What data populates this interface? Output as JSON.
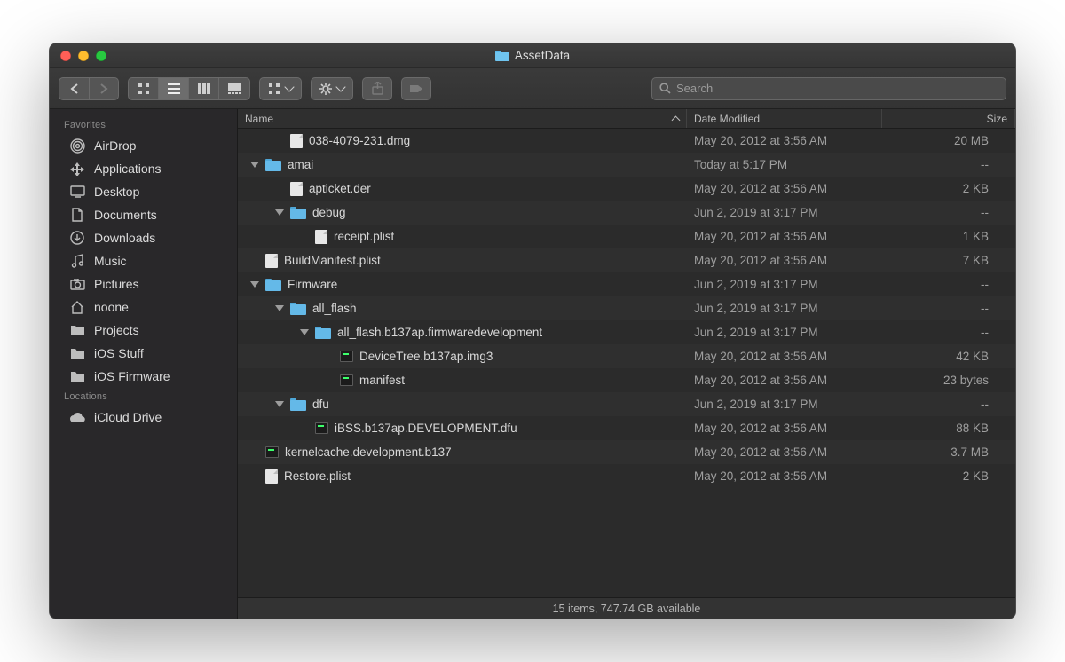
{
  "window": {
    "title": "AssetData"
  },
  "search": {
    "placeholder": "Search"
  },
  "columns": {
    "name": "Name",
    "date": "Date Modified",
    "size": "Size"
  },
  "sidebar": {
    "sections": [
      {
        "heading": "Favorites",
        "items": [
          {
            "icon": "airdrop",
            "label": "AirDrop"
          },
          {
            "icon": "apps",
            "label": "Applications"
          },
          {
            "icon": "desktop",
            "label": "Desktop"
          },
          {
            "icon": "documents",
            "label": "Documents"
          },
          {
            "icon": "downloads",
            "label": "Downloads"
          },
          {
            "icon": "music",
            "label": "Music"
          },
          {
            "icon": "pictures",
            "label": "Pictures"
          },
          {
            "icon": "home",
            "label": "noone"
          },
          {
            "icon": "folder",
            "label": "Projects"
          },
          {
            "icon": "folder",
            "label": "iOS Stuff"
          },
          {
            "icon": "folder",
            "label": "iOS Firmware"
          }
        ]
      },
      {
        "heading": "Locations",
        "items": [
          {
            "icon": "icloud",
            "label": "iCloud Drive"
          }
        ]
      }
    ]
  },
  "rows": [
    {
      "indent": 1,
      "disclosure": null,
      "kind": "doc",
      "name": "038-4079-231.dmg",
      "date": "May 20, 2012 at 3:56 AM",
      "size": "20 MB"
    },
    {
      "indent": 0,
      "disclosure": "open",
      "kind": "folder",
      "name": "amai",
      "date": "Today at 5:17 PM",
      "size": "--"
    },
    {
      "indent": 1,
      "disclosure": null,
      "kind": "doc",
      "name": "apticket.der",
      "date": "May 20, 2012 at 3:56 AM",
      "size": "2 KB"
    },
    {
      "indent": 1,
      "disclosure": "open",
      "kind": "folder",
      "name": "debug",
      "date": "Jun 2, 2019 at 3:17 PM",
      "size": "--"
    },
    {
      "indent": 2,
      "disclosure": null,
      "kind": "doc",
      "name": "receipt.plist",
      "date": "May 20, 2012 at 3:56 AM",
      "size": "1 KB"
    },
    {
      "indent": 0,
      "disclosure": null,
      "kind": "doc",
      "name": "BuildManifest.plist",
      "date": "May 20, 2012 at 3:56 AM",
      "size": "7 KB"
    },
    {
      "indent": 0,
      "disclosure": "open",
      "kind": "folder",
      "name": "Firmware",
      "date": "Jun 2, 2019 at 3:17 PM",
      "size": "--"
    },
    {
      "indent": 1,
      "disclosure": "open",
      "kind": "folder",
      "name": "all_flash",
      "date": "Jun 2, 2019 at 3:17 PM",
      "size": "--"
    },
    {
      "indent": 2,
      "disclosure": "open",
      "kind": "folder",
      "name": "all_flash.b137ap.firmwaredevelopment",
      "date": "Jun 2, 2019 at 3:17 PM",
      "size": "--"
    },
    {
      "indent": 3,
      "disclosure": null,
      "kind": "exec",
      "name": "DeviceTree.b137ap.img3",
      "date": "May 20, 2012 at 3:56 AM",
      "size": "42 KB"
    },
    {
      "indent": 3,
      "disclosure": null,
      "kind": "exec",
      "name": "manifest",
      "date": "May 20, 2012 at 3:56 AM",
      "size": "23 bytes"
    },
    {
      "indent": 1,
      "disclosure": "open",
      "kind": "folder",
      "name": "dfu",
      "date": "Jun 2, 2019 at 3:17 PM",
      "size": "--"
    },
    {
      "indent": 2,
      "disclosure": null,
      "kind": "exec",
      "name": "iBSS.b137ap.DEVELOPMENT.dfu",
      "date": "May 20, 2012 at 3:56 AM",
      "size": "88 KB"
    },
    {
      "indent": 0,
      "disclosure": null,
      "kind": "exec",
      "name": "kernelcache.development.b137",
      "date": "May 20, 2012 at 3:56 AM",
      "size": "3.7 MB"
    },
    {
      "indent": 0,
      "disclosure": null,
      "kind": "doc",
      "name": "Restore.plist",
      "date": "May 20, 2012 at 3:56 AM",
      "size": "2 KB"
    }
  ],
  "status": {
    "text": "15 items, 747.74 GB available"
  }
}
